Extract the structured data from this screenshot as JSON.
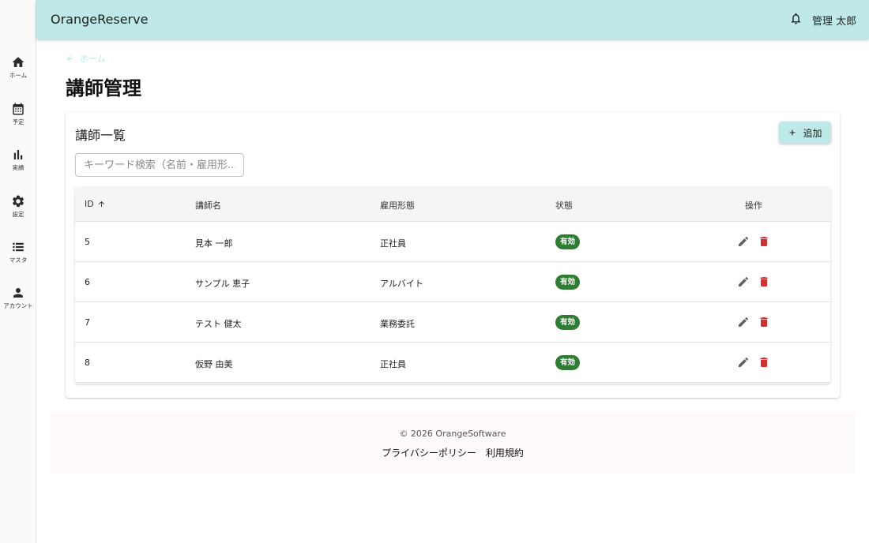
{
  "app": {
    "title": "OrangeReserve",
    "user": "管理 太郎"
  },
  "sidebar": {
    "items": [
      {
        "label": "ホーム",
        "icon": "home-icon"
      },
      {
        "label": "予定",
        "icon": "calendar-icon"
      },
      {
        "label": "実績",
        "icon": "bar-chart-icon"
      },
      {
        "label": "設定",
        "icon": "gear-icon"
      },
      {
        "label": "マスタ",
        "icon": "list-icon"
      },
      {
        "label": "アカウント",
        "icon": "person-icon"
      }
    ]
  },
  "breadcrumb": {
    "back": "ホーム"
  },
  "page": {
    "title": "講師管理"
  },
  "card": {
    "title": "講師一覧",
    "add_label": "追加",
    "search_placeholder": "キーワード検索（名前・雇用形..."
  },
  "table": {
    "headers": {
      "id": "ID",
      "name": "講師名",
      "employment": "雇用形態",
      "status": "状態",
      "actions": "操作"
    },
    "rows": [
      {
        "id": "5",
        "name": "見本 一郎",
        "employment": "正社員",
        "status": "有効"
      },
      {
        "id": "6",
        "name": "サンプル 恵子",
        "employment": "アルバイト",
        "status": "有効"
      },
      {
        "id": "7",
        "name": "テスト 健太",
        "employment": "業務委託",
        "status": "有効"
      },
      {
        "id": "8",
        "name": "仮野 由美",
        "employment": "正社員",
        "status": "有効"
      }
    ]
  },
  "footer": {
    "copyright": "© 2026 OrangeSoftware",
    "links": [
      "プライバシーポリシー",
      "利用規約"
    ]
  },
  "colors": {
    "appbar": "#bfe9e8",
    "status_active": "#2e7d32",
    "delete": "#d32f2f",
    "edit": "#616161"
  }
}
